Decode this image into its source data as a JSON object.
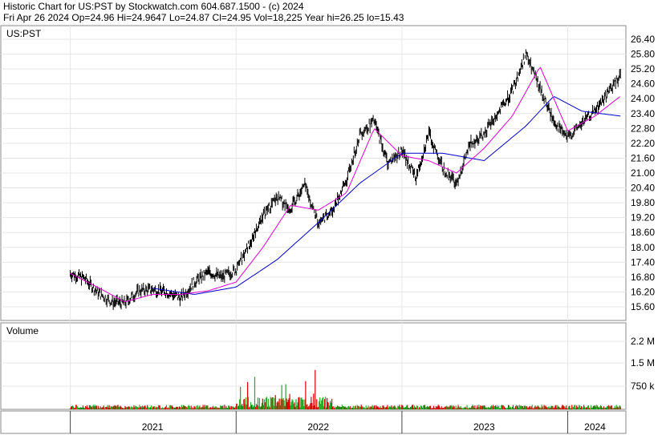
{
  "header": {
    "line1": "Historic Chart for US:PST by Stockwatch.com 604.687.1500 - (c) 2024",
    "line2": "Fri Apr 26 2024   Op=24.96   Hi=24.9647   Lo=24.87   Cl=24.95   Vol=18,225   Year hi=26.25   lo=15.43"
  },
  "price_panel": {
    "label": "US:PST"
  },
  "volume_panel": {
    "label": "Volume"
  },
  "colors": {
    "ma_short": "#e000d0",
    "ma_long": "#0000cc",
    "vol_up": "#22aa22",
    "vol_down": "#dd0000",
    "price": "#000000"
  },
  "chart_data": {
    "type": "line",
    "subtype": "high-low price bars with moving averages and volume bars",
    "x_labels": [
      "2021",
      "2022",
      "2023",
      "2024"
    ],
    "y_ticks": [
      "26.40",
      "25.80",
      "25.20",
      "24.60",
      "24.00",
      "23.40",
      "22.80",
      "22.20",
      "21.60",
      "21.00",
      "20.40",
      "19.80",
      "19.20",
      "18.60",
      "18.00",
      "17.40",
      "16.80",
      "16.20",
      "15.60"
    ],
    "volume_ticks": [
      "2.2 M",
      "1.5 M",
      "750 k"
    ],
    "ylim": [
      15.05,
      26.95
    ],
    "volume_max": 2800000,
    "price_path": [
      [
        "2021-01-01",
        16.95
      ],
      [
        "2021-02-01",
        16.75
      ],
      [
        "2021-03-01",
        16.2
      ],
      [
        "2021-04-01",
        15.8
      ],
      [
        "2021-05-01",
        15.75
      ],
      [
        "2021-06-01",
        16.25
      ],
      [
        "2021-07-01",
        16.3
      ],
      [
        "2021-08-01",
        16.2
      ],
      [
        "2021-09-01",
        15.95
      ],
      [
        "2021-10-01",
        16.6
      ],
      [
        "2021-11-01",
        17.0
      ],
      [
        "2021-12-01",
        16.8
      ],
      [
        "2022-01-01",
        17.1
      ],
      [
        "2022-02-01",
        18.2
      ],
      [
        "2022-03-01",
        19.3
      ],
      [
        "2022-04-01",
        20.0
      ],
      [
        "2022-05-01",
        19.6
      ],
      [
        "2022-06-01",
        20.5
      ],
      [
        "2022-07-01",
        19.0
      ],
      [
        "2022-08-01",
        19.5
      ],
      [
        "2022-09-01",
        20.7
      ],
      [
        "2022-10-01",
        22.6
      ],
      [
        "2022-11-01",
        23.1
      ],
      [
        "2022-12-01",
        21.4
      ],
      [
        "2023-01-01",
        21.9
      ],
      [
        "2023-02-01",
        20.8
      ],
      [
        "2023-03-01",
        22.6
      ],
      [
        "2023-04-01",
        21.2
      ],
      [
        "2023-05-01",
        20.6
      ],
      [
        "2023-06-01",
        22.2
      ],
      [
        "2023-07-01",
        22.6
      ],
      [
        "2023-08-01",
        23.4
      ],
      [
        "2023-09-01",
        24.3
      ],
      [
        "2023-10-01",
        25.8
      ],
      [
        "2023-11-01",
        24.4
      ],
      [
        "2023-12-01",
        23.1
      ],
      [
        "2024-01-01",
        22.4
      ],
      [
        "2024-02-01",
        23.0
      ],
      [
        "2024-03-01",
        23.5
      ],
      [
        "2024-04-26",
        24.95
      ]
    ],
    "ma_short": [
      [
        "2021-01-01",
        16.95
      ],
      [
        "2021-03-01",
        16.4
      ],
      [
        "2021-05-01",
        15.8
      ],
      [
        "2021-07-01",
        16.1
      ],
      [
        "2021-09-01",
        16.1
      ],
      [
        "2021-11-01",
        16.25
      ],
      [
        "2022-01-01",
        16.6
      ],
      [
        "2022-03-01",
        18.0
      ],
      [
        "2022-05-01",
        19.7
      ],
      [
        "2022-07-01",
        19.5
      ],
      [
        "2022-09-01",
        20.2
      ],
      [
        "2022-11-01",
        22.8
      ],
      [
        "2023-01-01",
        21.7
      ],
      [
        "2023-03-01",
        21.5
      ],
      [
        "2023-05-01",
        21.0
      ],
      [
        "2023-07-01",
        22.0
      ],
      [
        "2023-09-01",
        23.3
      ],
      [
        "2023-11-01",
        25.3
      ],
      [
        "2024-01-01",
        22.7
      ],
      [
        "2024-03-01",
        23.3
      ],
      [
        "2024-04-26",
        24.1
      ]
    ],
    "ma_long": [
      [
        "2021-07-01",
        16.35
      ],
      [
        "2021-10-01",
        16.1
      ],
      [
        "2022-01-01",
        16.4
      ],
      [
        "2022-04-01",
        17.5
      ],
      [
        "2022-07-01",
        19.0
      ],
      [
        "2022-10-01",
        20.6
      ],
      [
        "2023-01-01",
        21.8
      ],
      [
        "2023-04-01",
        21.8
      ],
      [
        "2023-07-01",
        21.5
      ],
      [
        "2023-10-01",
        22.9
      ],
      [
        "2023-12-01",
        24.1
      ],
      [
        "2024-02-01",
        23.5
      ],
      [
        "2024-04-26",
        23.3
      ]
    ]
  }
}
